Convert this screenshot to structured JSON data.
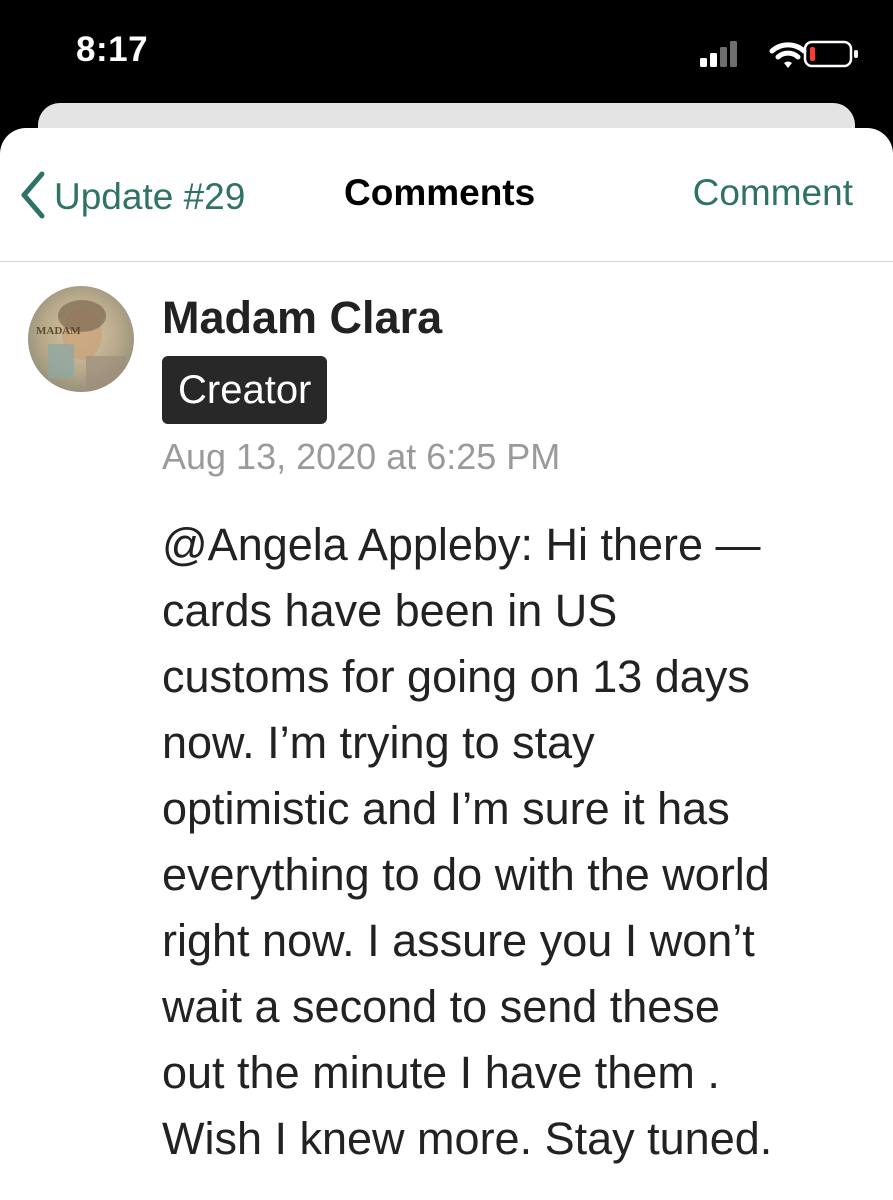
{
  "status_bar": {
    "time": "8:17",
    "icons": [
      "cellular-signal-icon",
      "wifi-icon",
      "battery-low-icon"
    ],
    "battery_color": "#ff3b30"
  },
  "nav": {
    "back_label": "Update #29",
    "title": "Comments",
    "action_label": "Comment",
    "accent_color": "#2f7266"
  },
  "comment": {
    "author": "Madam Clara",
    "badge": "Creator",
    "timestamp": "Aug 13, 2020 at 6:25 PM",
    "avatar_text": "MADAM",
    "body_lines": [
      "@Angela Appleby: Hi there —",
      "cards have been in US",
      "customs for going on 13 days",
      "now. I’m trying to stay",
      "optimistic and I’m sure it has",
      "everything to do with the world",
      "right now. I assure you I won’t",
      "wait a second to send these",
      "out the minute I have them .",
      "Wish I knew more. Stay tuned."
    ]
  }
}
